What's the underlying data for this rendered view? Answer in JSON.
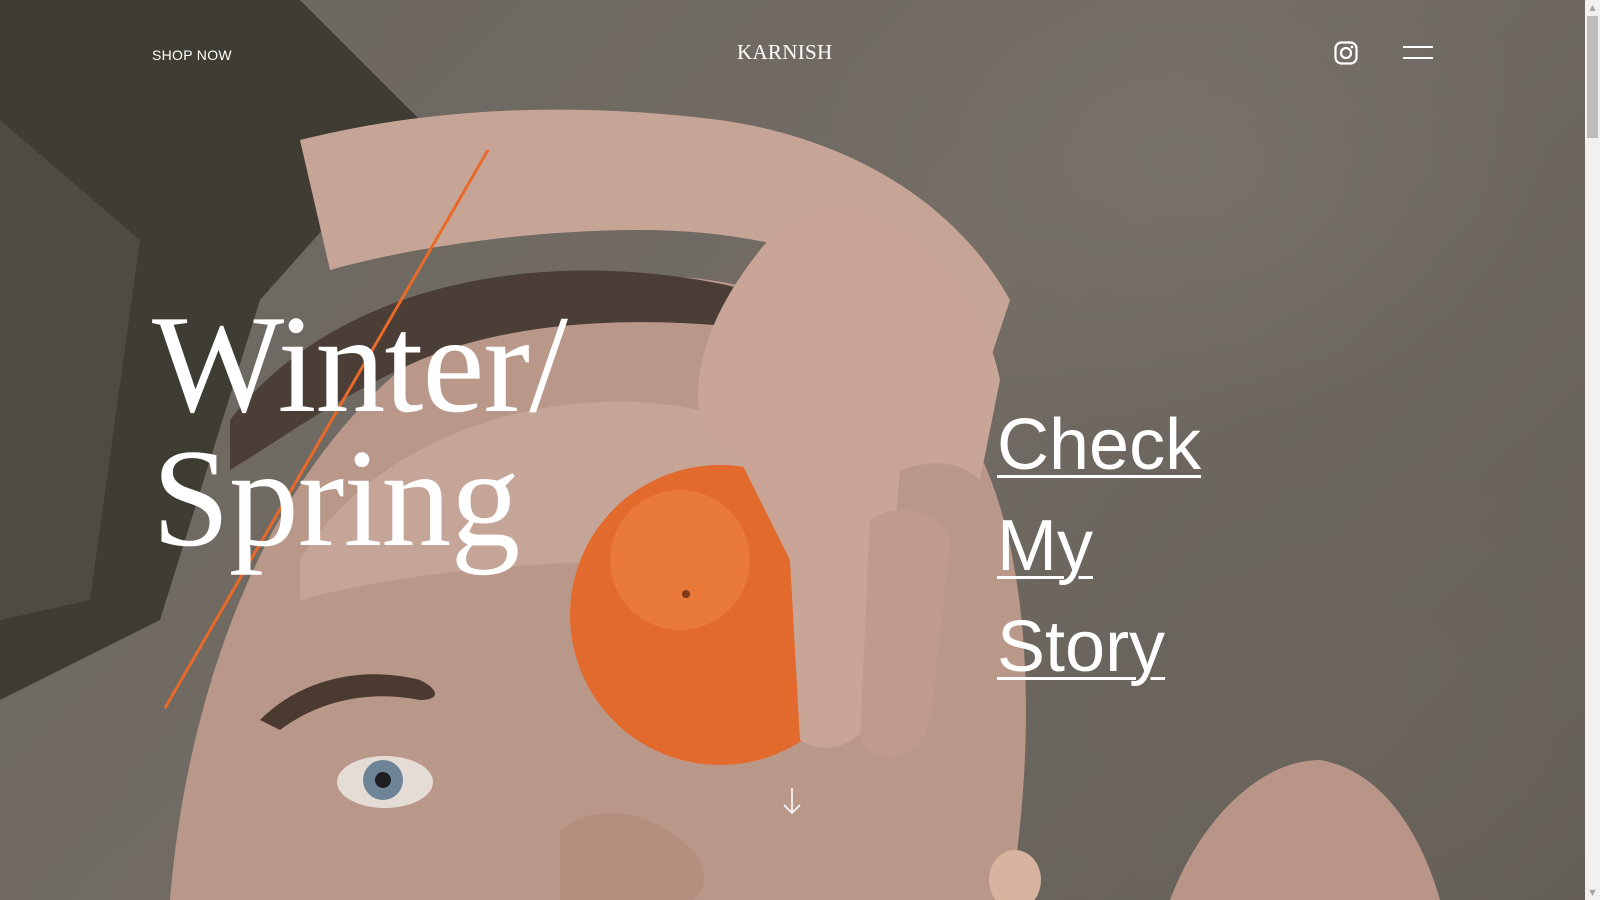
{
  "header": {
    "shop_label": "SHOP NOW",
    "brand": "KARNISH",
    "social_icon": "instagram-icon",
    "menu_icon": "hamburger-menu-icon"
  },
  "hero": {
    "headline_line1": "Winter/",
    "headline_line2": "Spring",
    "cta_line1": "Check",
    "cta_line2": "My",
    "cta_line3": "Story",
    "scroll_icon": "arrow-down-icon",
    "accent_color": "#e86a2a",
    "background_image": "portrait-with-orange"
  },
  "scrollbar": {
    "up_icon": "scroll-up-arrow",
    "down_icon": "scroll-down-arrow"
  }
}
